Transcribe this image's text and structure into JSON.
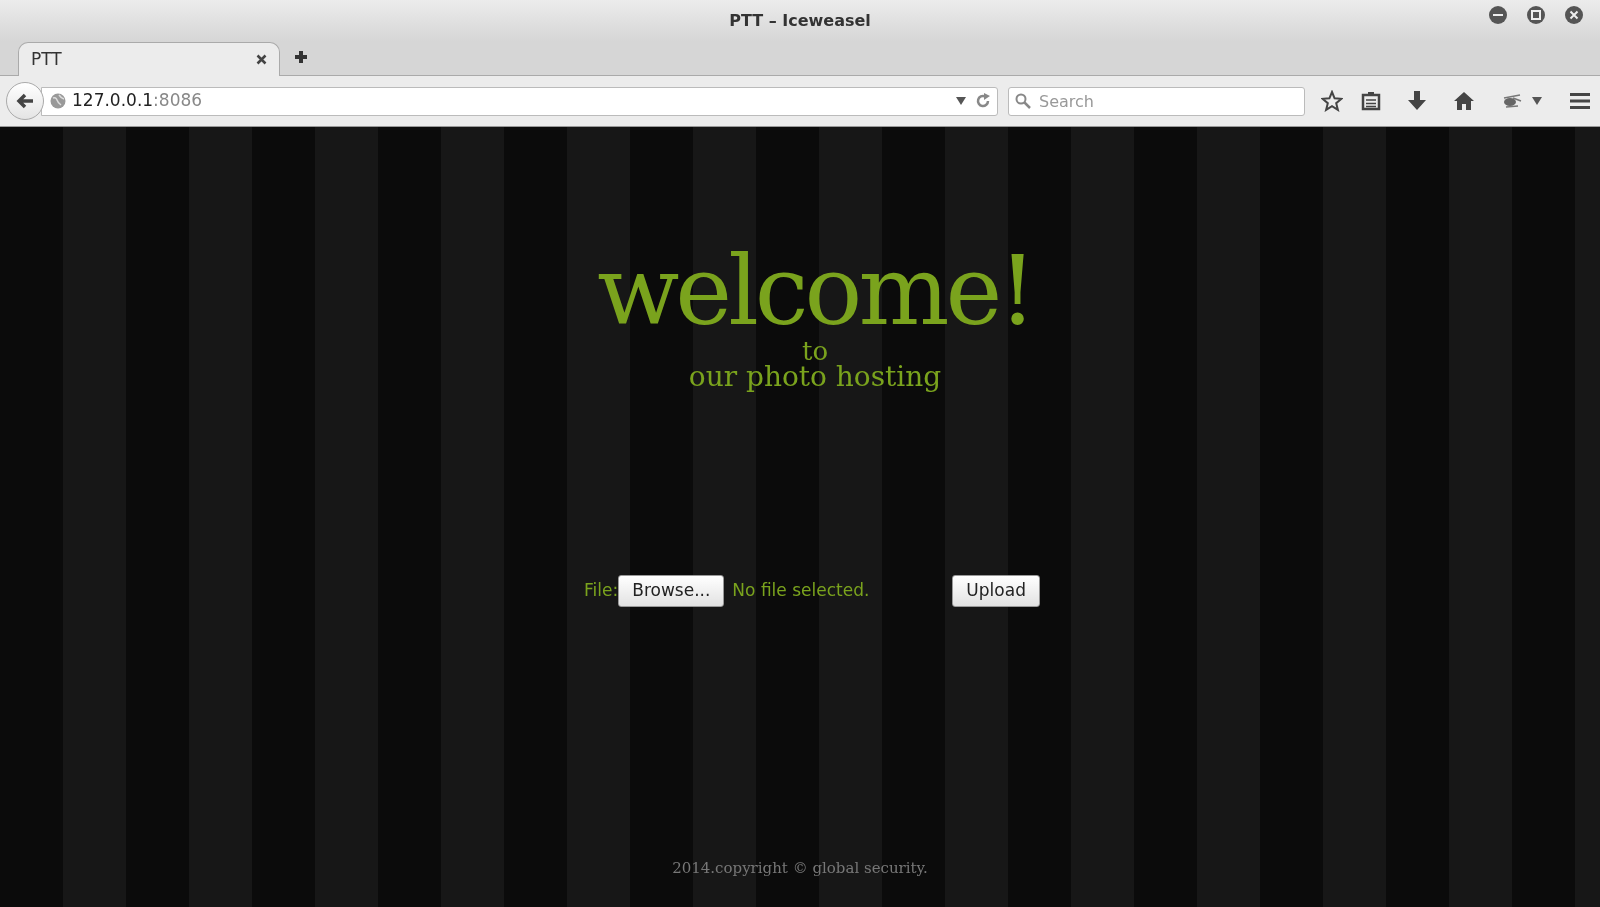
{
  "window": {
    "title": "PTT – Iceweasel"
  },
  "tabs": [
    {
      "label": "PTT",
      "selected": true
    }
  ],
  "address_bar": {
    "host": "127.0.0.1",
    "port": ":8086"
  },
  "search": {
    "placeholder": "Search"
  },
  "page": {
    "heading": "welcome!",
    "subheading_1": "to",
    "subheading_2": "our photo hosting",
    "upload_form": {
      "label": "File:",
      "browse_button": "Browse...",
      "file_status": "No file selected.",
      "upload_button": "Upload"
    },
    "footer": "2014.copyright © global security."
  }
}
